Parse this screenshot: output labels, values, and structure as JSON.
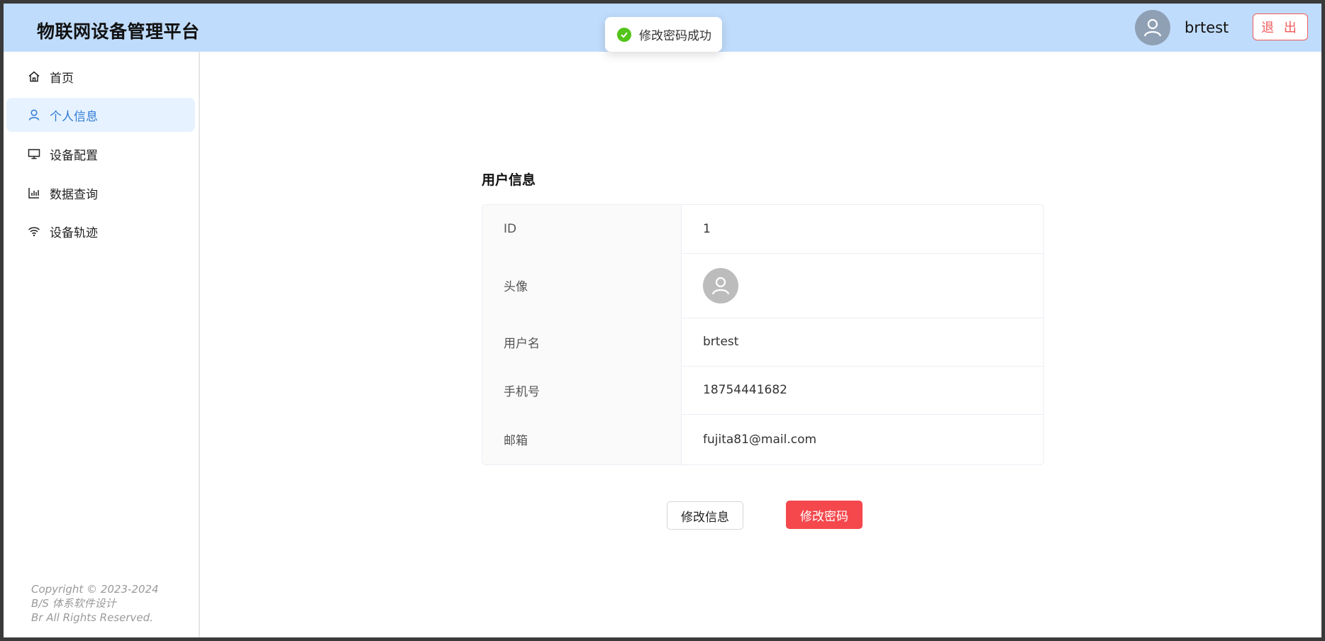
{
  "header": {
    "app_title": "物联网设备管理平台",
    "username": "brtest",
    "logout_label": "退 出"
  },
  "toast": {
    "message": "修改密码成功",
    "icon": "check-circle-icon",
    "color": "#52c41a"
  },
  "sidebar": {
    "items": [
      {
        "label": "首页",
        "icon": "home-icon"
      },
      {
        "label": "个人信息",
        "icon": "user-icon",
        "active": true
      },
      {
        "label": "设备配置",
        "icon": "monitor-icon"
      },
      {
        "label": "数据查询",
        "icon": "bar-chart-icon"
      },
      {
        "label": "设备轨迹",
        "icon": "wifi-icon"
      }
    ],
    "copyright": [
      "Copyright © 2023-2024",
      "B/S 体系软件设计",
      "Br All Rights Reserved."
    ]
  },
  "main": {
    "section_title": "用户信息",
    "rows": [
      {
        "label": "ID",
        "value": "1"
      },
      {
        "label": "头像",
        "value": ""
      },
      {
        "label": "用户名",
        "value": "brtest"
      },
      {
        "label": "手机号",
        "value": "18754441682"
      },
      {
        "label": "邮箱",
        "value": "fujita81@mail.com"
      }
    ],
    "edit_info_label": "修改信息",
    "change_password_label": "修改密码"
  },
  "colors": {
    "header_bg": "#c0dcfc",
    "accent": "#2f7bd6",
    "danger": "#f4484d",
    "success": "#52c41a"
  }
}
